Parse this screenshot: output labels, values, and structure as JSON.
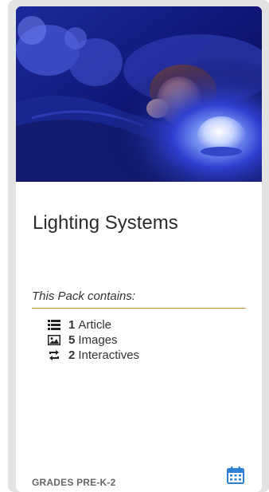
{
  "card": {
    "title": "Lighting Systems",
    "pack_heading": "This Pack contains:",
    "contents": [
      {
        "icon": "list-icon",
        "count": "1",
        "label": "Article"
      },
      {
        "icon": "image-icon",
        "count": "5",
        "label": "Images"
      },
      {
        "icon": "interactive-icon",
        "count": "2",
        "label": "Interactives"
      }
    ],
    "grades": "GRADES PRE-K-2",
    "calendar_icon": "calendar-icon",
    "accent_color": "#c89a3c",
    "icon_color": "#2f7fd6"
  }
}
